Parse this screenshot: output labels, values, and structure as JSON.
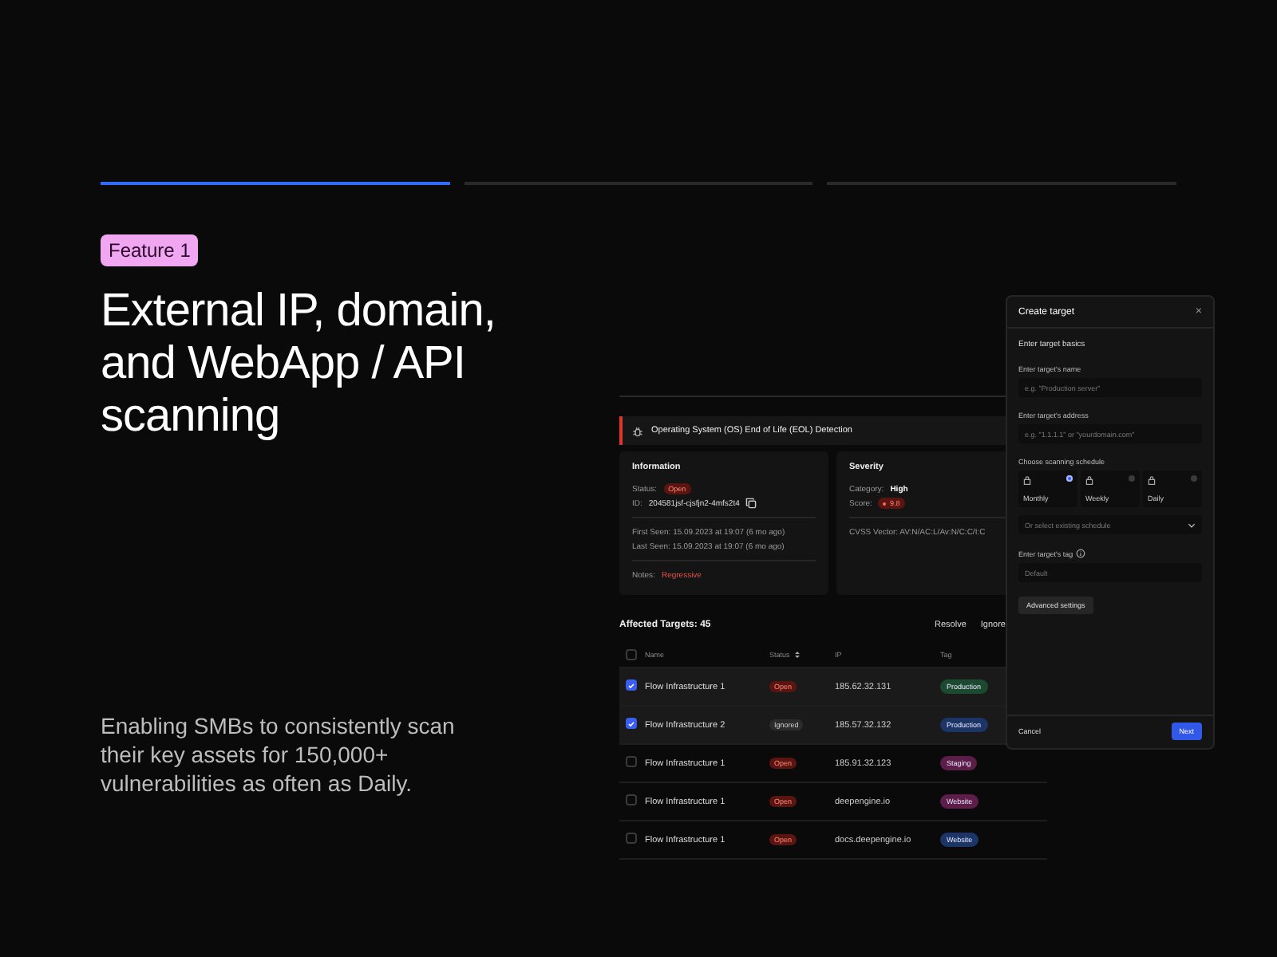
{
  "steps": [
    {
      "selected": true
    },
    {
      "selected": false
    },
    {
      "selected": false
    }
  ],
  "badge": "Feature 1",
  "headline": "External IP, domain, and WebApp / API scanning",
  "description": "Enabling SMBs to consistently scan their key assets for 150,000+ vulnerabilities as often as Daily.",
  "app": {
    "alert_title": "Operating System (OS) End of Life (EOL) Detection",
    "information": {
      "title": "Information",
      "status_label": "Status:",
      "status": "Open",
      "id_label": "ID:",
      "id": "204581jsf-cjsfjn2-4mfs2t4",
      "first_seen": "First Seen:  15.09.2023 at 19:07 (6 mo ago)",
      "last_seen": "Last Seen:  15.09.2023 at 19:07 (6 mo ago)",
      "notes_label": "Notes:",
      "notes": "Regressive"
    },
    "severity": {
      "title": "Severity",
      "category_label": "Category:",
      "category": "High",
      "score_label": "Score:",
      "score": "9.8",
      "cvss": "CVSS Vector:  AV:N/AC:L/Av:N/C:C/I:C"
    },
    "targets": {
      "title": "Affected Targets: 45",
      "actions": [
        "Resolve",
        "Ignore"
      ],
      "columns": [
        "Name",
        "Status",
        "IP",
        "Tag"
      ],
      "select_all_checked": false,
      "rows": [
        {
          "checked": true,
          "name": "Flow Infrastructure 1",
          "status": "Open",
          "kind": "open",
          "ip": "185.62.32.131",
          "tag": "Production",
          "color": "#1c4a30"
        },
        {
          "checked": true,
          "name": "Flow Infrastructure 2",
          "status": "Ignored",
          "kind": "ignored",
          "ip": "185.57.32.132",
          "tag": "Production",
          "color": "#1c3566"
        },
        {
          "checked": false,
          "name": "Flow Infrastructure 1",
          "status": "Open",
          "kind": "open",
          "ip": "185.91.32.123",
          "tag": "Staging",
          "color": "#5c1d48"
        },
        {
          "checked": false,
          "name": "Flow Infrastructure 1",
          "status": "Open",
          "kind": "open",
          "ip": "deepengine.io",
          "tag": "Website",
          "color": "#5c1d48"
        },
        {
          "checked": false,
          "name": "Flow Infrastructure 1",
          "status": "Open",
          "kind": "open",
          "ip": "docs.deepengine.io",
          "tag": "Website",
          "color": "#1c3566"
        }
      ]
    }
  },
  "modal": {
    "title": "Create target",
    "close": "×",
    "section": "Enter target basics",
    "fields": [
      {
        "label": "Enter target's name",
        "placeholder": "e.g. \"Production server\""
      },
      {
        "label": "Enter target's address",
        "placeholder": "e.g. \"1.1.1.1\" or \"yourdomain.com\""
      }
    ],
    "schedule_label": "Choose scanning schedule",
    "schedules": [
      {
        "label": "Monthly",
        "selected": true
      },
      {
        "label": "Weekly",
        "selected": false
      },
      {
        "label": "Daily",
        "selected": false
      }
    ],
    "existing_placeholder": "Or select existing schedule",
    "tag_label": "Enter target's tag",
    "tag_placeholder": "Default",
    "advanced": "Advanced settings",
    "cancel": "Cancel",
    "next": "Next"
  }
}
